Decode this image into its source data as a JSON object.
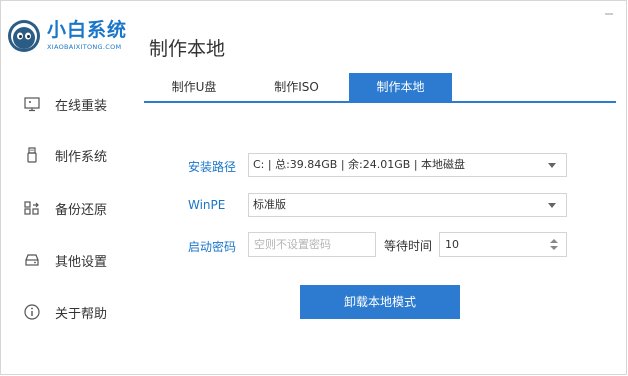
{
  "app": {
    "logo_title": "小白系统",
    "logo_subtitle": "XIAOBAIXITONG.COM",
    "brand_color": "#1a76c8",
    "accent_color": "#2d7bd0"
  },
  "sidebar": {
    "items": [
      {
        "label": "在线重装",
        "icon": "monitor-icon"
      },
      {
        "label": "制作系统",
        "icon": "usb-icon"
      },
      {
        "label": "备份还原",
        "icon": "backup-grid-icon"
      },
      {
        "label": "其他设置",
        "icon": "drive-settings-icon"
      },
      {
        "label": "关于帮助",
        "icon": "info-icon"
      }
    ]
  },
  "main": {
    "title": "制作本地",
    "tabs": [
      {
        "label": "制作U盘",
        "active": false
      },
      {
        "label": "制作ISO",
        "active": false
      },
      {
        "label": "制作本地",
        "active": true
      }
    ],
    "form": {
      "install_path_label": "安装路径",
      "install_path_value": "C: | 总:39.84GB | 余:24.01GB | 本地磁盘",
      "winpe_label": "WinPE",
      "winpe_value": "标准版",
      "boot_password_label": "启动密码",
      "boot_password_placeholder": "空则不设置密码",
      "wait_time_label": "等待时间",
      "wait_time_value": "10"
    },
    "action_button": "卸载本地模式"
  }
}
